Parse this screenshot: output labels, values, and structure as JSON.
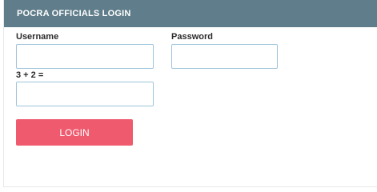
{
  "login_panel": {
    "title": "POCRA OFFICIALS LOGIN",
    "username_label": "Username",
    "username_value": "",
    "password_label": "Password",
    "password_value": "",
    "captcha_label": "3 + 2 =",
    "captcha_value": "",
    "login_button": "LOGIN"
  },
  "colors": {
    "header_bg": "#5f7d8a",
    "button_bg": "#ef5a6e",
    "input_border": "#9fc3dd"
  }
}
